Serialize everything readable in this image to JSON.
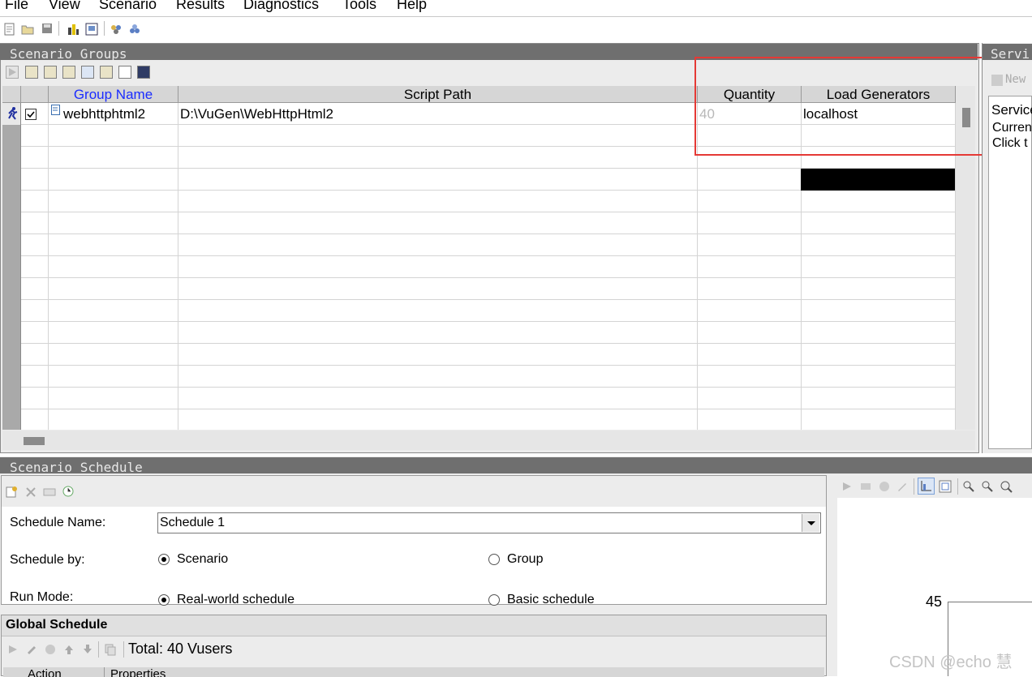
{
  "menu": [
    "File",
    "View",
    "Scenario",
    "Results",
    "Diagnostics",
    "Tools",
    "Help"
  ],
  "main_toolbar_icons": [
    "new-scenario-icon",
    "open-icon",
    "save-icon",
    "design-groups-icon",
    "run-scenario-icon",
    "vusers-icon",
    "load-generators-icon"
  ],
  "scenario_groups": {
    "title": "Scenario Groups",
    "toolbar_icons": [
      "play-icon",
      "add-group-icon",
      "add-vusers-icon",
      "remove-group-icon",
      "copy-group-icon",
      "details-icon",
      "script-icon",
      "runtime-settings-icon"
    ],
    "columns": {
      "group_name": "Group Name",
      "script_path": "Script Path",
      "quantity": "Quantity",
      "load_generators": "Load Generators"
    },
    "rows": [
      {
        "group_name": "webhttphtml2",
        "script_path": "D:\\VuGen\\WebHttpHtml2",
        "quantity": "40",
        "load_generators": "localhost",
        "enabled": true
      }
    ],
    "highlight_color": "#e53935"
  },
  "service_panel": {
    "title": "Servi",
    "new_button": "New",
    "heading": "Service",
    "line1": "Curren",
    "line2": "Click t"
  },
  "scenario_schedule": {
    "title": "Scenario Schedule",
    "toolbar_icons": [
      "new-schedule-icon",
      "delete-icon",
      "rename-icon",
      "schedule-settings-icon"
    ],
    "schedule_name_label": "Schedule Name:",
    "schedule_name_value": "Schedule 1",
    "schedule_by_label": "Schedule by:",
    "schedule_by_options": [
      "Scenario",
      "Group"
    ],
    "schedule_by_selected": "Scenario",
    "run_mode_label": "Run Mode:",
    "run_mode_options": [
      "Real-world schedule",
      "Basic schedule"
    ],
    "run_mode_selected": "Real-world schedule",
    "global_schedule_title": "Global Schedule",
    "total_text": "Total: 40 Vusers",
    "table_columns": [
      "Action",
      "Properties"
    ]
  },
  "graph": {
    "toolbar_icons": [
      "play-icon",
      "edit-icon",
      "delete-icon",
      "pencil-icon",
      "graph-view-icon",
      "fit-icon",
      "zoom-in-icon",
      "zoom-out-icon",
      "zoom-reset-icon"
    ],
    "y_label_top": "45"
  },
  "watermark": "CSDN @echo 慧"
}
